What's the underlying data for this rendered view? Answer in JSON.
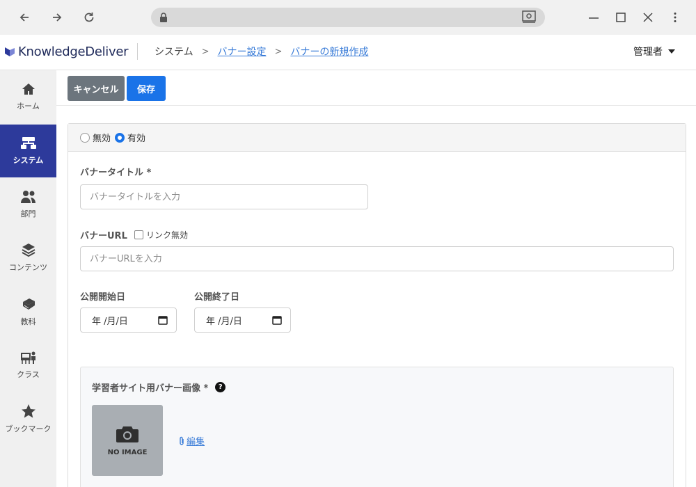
{
  "browser": {
    "back_icon": "arrow-left-icon",
    "forward_icon": "arrow-right-icon",
    "reload_icon": "reload-icon",
    "lock_icon": "lock-icon",
    "minimize_icon": "minimize-icon",
    "maximize_icon": "maximize-icon",
    "close_icon": "close-icon",
    "menu_icon": "kebab-menu-icon"
  },
  "header": {
    "logo_prefix": "Knowledge",
    "logo_suffix": "eliver",
    "logo_D": "D",
    "breadcrumb": [
      "システム",
      "バナー設定",
      "バナーの新規作成"
    ],
    "user_label": "管理者"
  },
  "sidebar": {
    "items": [
      {
        "label": "ホーム",
        "icon": "home-icon"
      },
      {
        "label": "システム",
        "icon": "system-icon",
        "active": true
      },
      {
        "label": "部門",
        "icon": "users-icon"
      },
      {
        "label": "コンテンツ",
        "icon": "layers-icon"
      },
      {
        "label": "教科",
        "icon": "book-icon"
      },
      {
        "label": "クラス",
        "icon": "classroom-icon"
      },
      {
        "label": "ブックマーク",
        "icon": "star-icon"
      }
    ]
  },
  "toolbar": {
    "cancel_label": "キャンセル",
    "save_label": "保存"
  },
  "form": {
    "status": {
      "options": [
        "無効",
        "有効"
      ],
      "selected": "有効"
    },
    "title_label": "バナータイトル *",
    "title_placeholder": "バナータイトルを入力",
    "url_label": "バナーURL",
    "link_disabled_label": "リンク無効",
    "url_placeholder": "バナーURLを入力",
    "start_label": "公開開始日",
    "end_label": "公開終了日",
    "start_value": "年 /月/日",
    "end_value": "年 /月/日",
    "image_label": "学習者サイト用バナー画像 *",
    "image_help": "?",
    "no_image_text": "NO IMAGE",
    "edit_label": "編集"
  },
  "colors": {
    "sidebar_active": "#2d3a9b",
    "primary": "#1a73e8",
    "secondary": "#6c757d",
    "link": "#3b7dd8"
  }
}
